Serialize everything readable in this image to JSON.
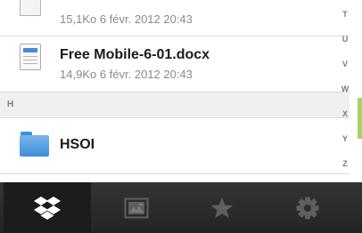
{
  "file_list": {
    "partial_row": {
      "meta": "15,1Ko  6 févr. 2012 20:43"
    },
    "document_row": {
      "name": "Free Mobile-6-01.docx",
      "meta": "14,9Ko  6 févr. 2012 20:43",
      "icon": "docx-file-icon"
    },
    "section_header": "H",
    "folder_row": {
      "name": "HSOI",
      "icon": "folder-icon"
    }
  },
  "index_bar": {
    "letters": [
      "T",
      "U",
      "V",
      "W",
      "X",
      "Y",
      "Z"
    ]
  },
  "tab_bar": {
    "tabs": [
      {
        "icon": "dropbox-icon",
        "active": true
      },
      {
        "icon": "photos-icon",
        "active": false
      },
      {
        "icon": "star-icon",
        "active": false
      },
      {
        "icon": "gear-icon",
        "active": false
      }
    ]
  },
  "colors": {
    "folder_blue": "#4a90d9",
    "scroll_indicator": "#a6d16c",
    "tabbar_background": "#2a2a2a"
  }
}
